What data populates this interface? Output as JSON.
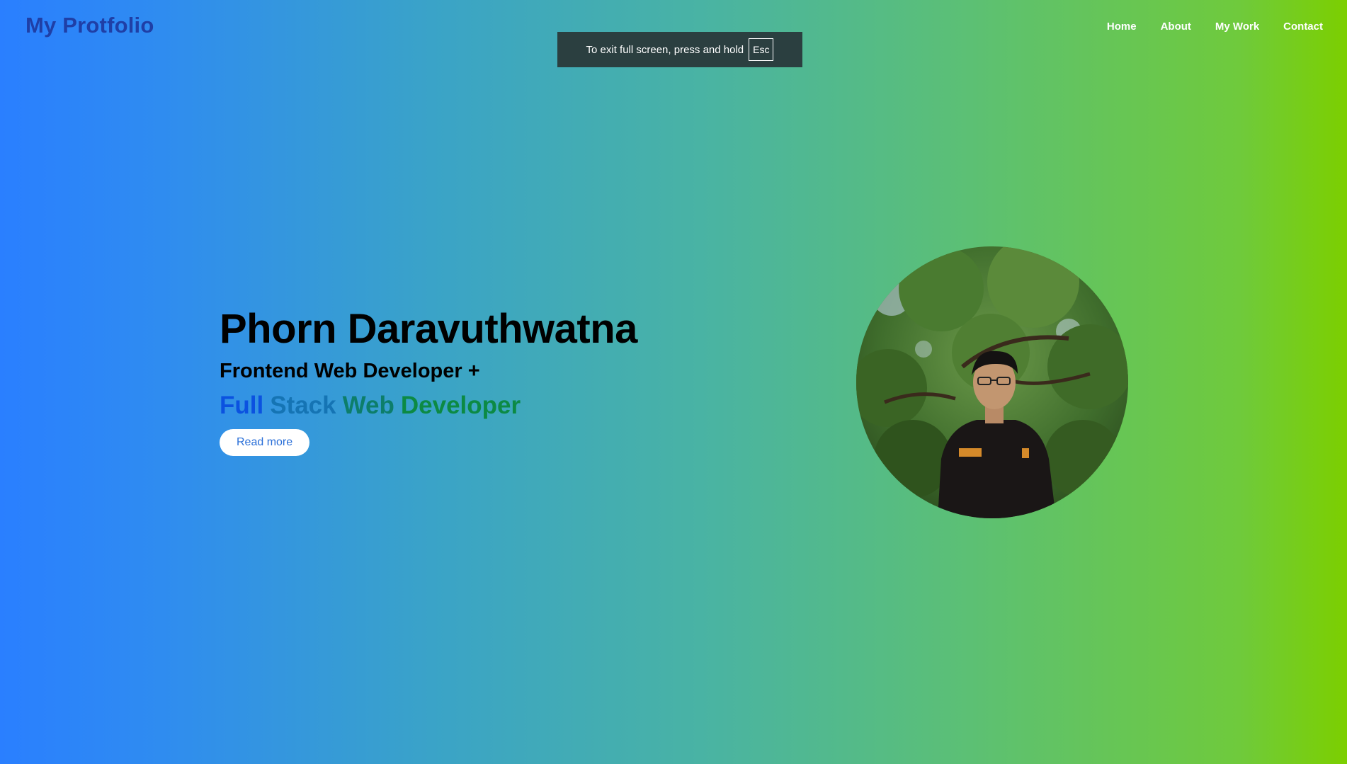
{
  "header": {
    "logo": "My Protfolio",
    "nav": [
      "Home",
      "About",
      "My Work",
      "Contact"
    ]
  },
  "fullscreen_toast": {
    "message": "To exit full screen, press and hold",
    "key": "Esc"
  },
  "hero": {
    "name": "Phorn Daravuthwatna",
    "role": "Frontend Web Developer +",
    "stack_words": [
      "Full",
      "Stack",
      "Web",
      "Developer"
    ],
    "button": "Read more"
  },
  "colors": {
    "gradient_start": "#2a7fff",
    "gradient_end": "#7ccf00",
    "logo": "#1f3fa6",
    "toast_bg": "#2b3f40"
  }
}
